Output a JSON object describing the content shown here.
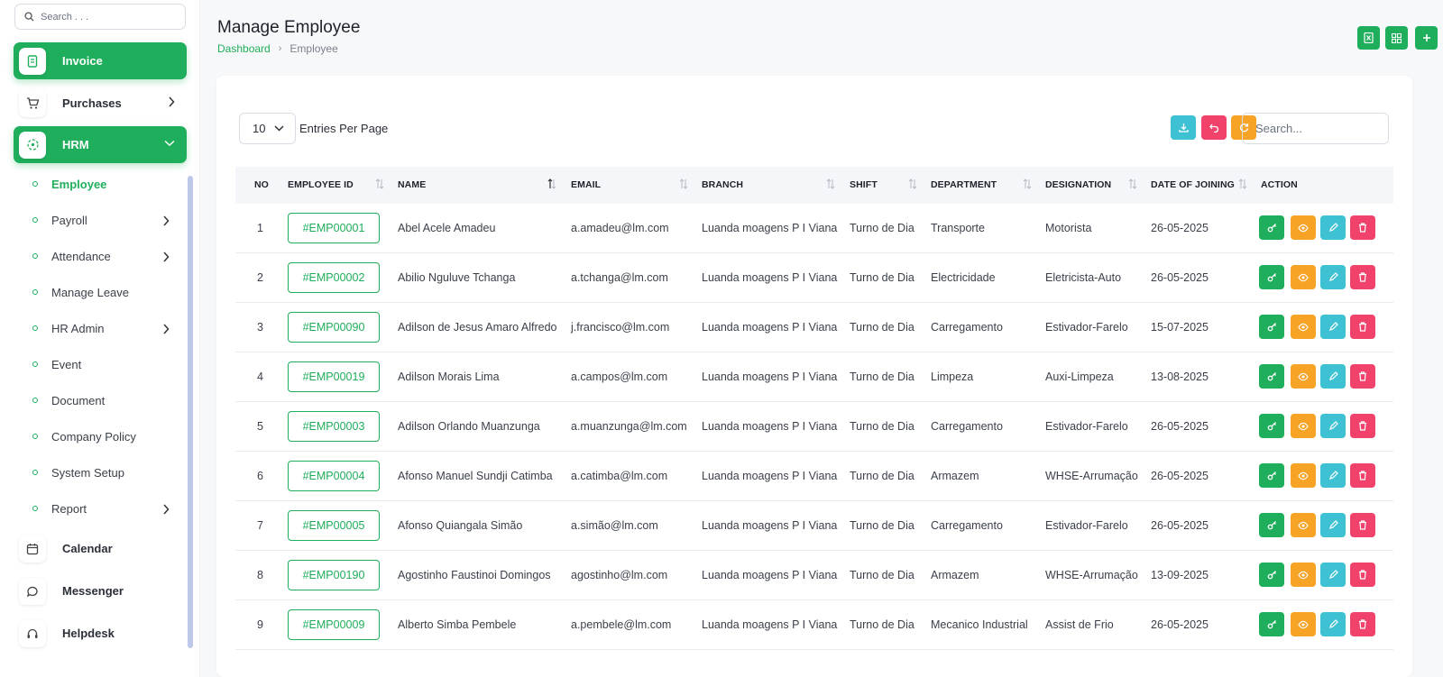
{
  "sidebar": {
    "search_placeholder": "Search . . .",
    "invoice": "Invoice",
    "purchases": "Purchases",
    "hrm": "HRM",
    "sub_items": [
      {
        "label": "Employee",
        "active": true,
        "has_children": false
      },
      {
        "label": "Payroll",
        "active": false,
        "has_children": true
      },
      {
        "label": "Attendance",
        "active": false,
        "has_children": true
      },
      {
        "label": "Manage Leave",
        "active": false,
        "has_children": false
      },
      {
        "label": "HR Admin",
        "active": false,
        "has_children": true
      },
      {
        "label": "Event",
        "active": false,
        "has_children": false
      },
      {
        "label": "Document",
        "active": false,
        "has_children": false
      },
      {
        "label": "Company Policy",
        "active": false,
        "has_children": false
      },
      {
        "label": "System Setup",
        "active": false,
        "has_children": false
      },
      {
        "label": "Report",
        "active": false,
        "has_children": true
      }
    ],
    "calendar": "Calendar",
    "messenger": "Messenger",
    "helpdesk": "Helpdesk"
  },
  "header": {
    "title": "Manage Employee",
    "breadcrumb_home": "Dashboard",
    "breadcrumb_current": "Employee",
    "actions": [
      "excel-export-icon",
      "grid-view-icon",
      "plus-icon"
    ]
  },
  "toolbar": {
    "per_page_value": "10",
    "per_page_label": "Entries Per Page",
    "search_placeholder": "Search...",
    "buttons": [
      "download-icon",
      "undo-icon",
      "refresh-icon"
    ]
  },
  "colors": {
    "brand_green": "#1fae5b",
    "orange": "#f7a325",
    "cyan": "#3ec1d3",
    "pink": "#f0426b"
  },
  "table": {
    "columns": [
      "NO",
      "EMPLOYEE ID",
      "NAME",
      "EMAIL",
      "BRANCH",
      "SHIFT",
      "DEPARTMENT",
      "DESIGNATION",
      "DATE OF JOINING",
      "ACTION"
    ],
    "rows": [
      {
        "no": "1",
        "id": "#EMP00001",
        "name": "Abel Acele Amadeu",
        "email": "a.amadeu@lm.com",
        "branch": "Luanda moagens P I Viana",
        "shift": "Turno de Dia",
        "department": "Transporte",
        "designation": "Motorista",
        "doj": "26-05-2025"
      },
      {
        "no": "2",
        "id": "#EMP00002",
        "name": "Abilio Nguluve Tchanga",
        "email": "a.tchanga@lm.com",
        "branch": "Luanda moagens P I Viana",
        "shift": "Turno de Dia",
        "department": "Electricidade",
        "designation": "Eletricista-Auto",
        "doj": "26-05-2025"
      },
      {
        "no": "3",
        "id": "#EMP00090",
        "name": "Adilson de Jesus Amaro Alfredo",
        "email": "j.francisco@lm.com",
        "branch": "Luanda moagens P I Viana",
        "shift": "Turno de Dia",
        "department": "Carregamento",
        "designation": "Estivador-Farelo",
        "doj": "15-07-2025"
      },
      {
        "no": "4",
        "id": "#EMP00019",
        "name": "Adilson Morais Lima",
        "email": "a.campos@lm.com",
        "branch": "Luanda moagens P I Viana",
        "shift": "Turno de Dia",
        "department": "Limpeza",
        "designation": "Auxi-Limpeza",
        "doj": "13-08-2025"
      },
      {
        "no": "5",
        "id": "#EMP00003",
        "name": "Adilson Orlando Muanzunga",
        "email": "a.muanzunga@lm.com",
        "branch": "Luanda moagens P I Viana",
        "shift": "Turno de Dia",
        "department": "Carregamento",
        "designation": "Estivador-Farelo",
        "doj": "26-05-2025"
      },
      {
        "no": "6",
        "id": "#EMP00004",
        "name": "Afonso Manuel Sundji Catimba",
        "email": "a.catimba@lm.com",
        "branch": "Luanda moagens P I Viana",
        "shift": "Turno de Dia",
        "department": "Armazem",
        "designation": "WHSE-Arrumação",
        "doj": "26-05-2025"
      },
      {
        "no": "7",
        "id": "#EMP00005",
        "name": "Afonso Quiangala Simão",
        "email": "a.simão@lm.com",
        "branch": "Luanda moagens P I Viana",
        "shift": "Turno de Dia",
        "department": "Carregamento",
        "designation": "Estivador-Farelo",
        "doj": "26-05-2025"
      },
      {
        "no": "8",
        "id": "#EMP00190",
        "name": "Agostinho Faustinoi Domingos",
        "email": "agostinho@lm.com",
        "branch": "Luanda moagens P I Viana",
        "shift": "Turno de Dia",
        "department": "Armazem",
        "designation": "WHSE-Arrumação",
        "doj": "13-09-2025"
      },
      {
        "no": "9",
        "id": "#EMP00009",
        "name": "Alberto Simba Pembele",
        "email": "a.pembele@lm.com",
        "branch": "Luanda moagens P I Viana",
        "shift": "Turno de Dia",
        "department": "Mecanico Industrial",
        "designation": "Assist de Frio",
        "doj": "26-05-2025"
      }
    ],
    "row_actions": [
      "key-icon",
      "eye-icon",
      "pencil-icon",
      "trash-icon"
    ]
  }
}
